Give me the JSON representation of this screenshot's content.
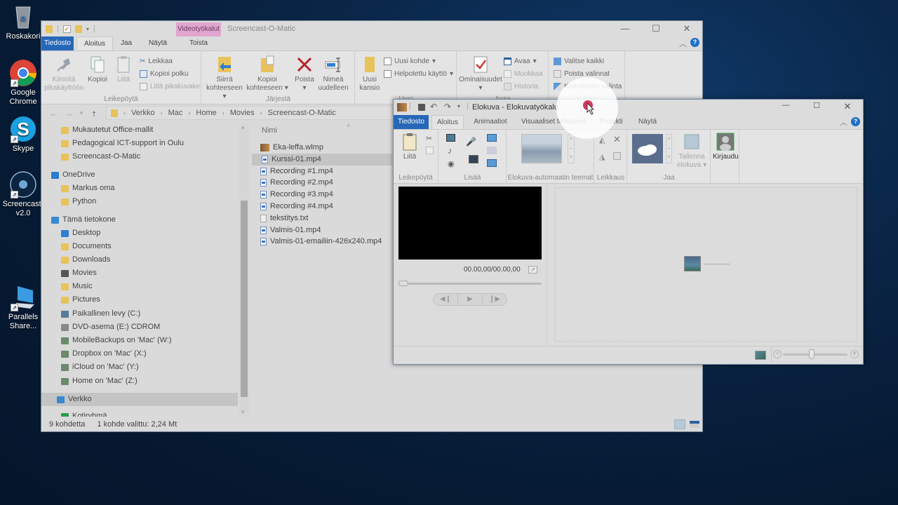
{
  "desktop": {
    "icons": [
      {
        "label": "Roskakori",
        "icon": "recycle-bin-icon"
      },
      {
        "label": "Google Chrome",
        "icon": "chrome-icon"
      },
      {
        "label": "Skype",
        "icon": "skype-icon"
      },
      {
        "label": "Screencast-v2.0",
        "icon": "screencast-icon"
      },
      {
        "label": "Parallels Share...",
        "icon": "parallels-share-icon"
      }
    ]
  },
  "explorer": {
    "title": "Screencast-O-Matic",
    "context_tab": "Videotyökalut",
    "tabs": [
      "Tiedosto",
      "Aloitus",
      "Jaa",
      "Näytä",
      "Toista"
    ],
    "ribbon": {
      "leikepoyta": {
        "label": "Leikepöytä",
        "pin": "Kiinnitä pikakäyttöön",
        "copy": "Kopioi",
        "paste": "Liitä",
        "cut": "Leikkaa",
        "copy_path": "Kopioi polku",
        "paste_shortcut": "Liitä pikakuvake"
      },
      "jarjesta": {
        "label": "Järjestä",
        "move_to": "Siirrä kohteeseen",
        "copy_to": "Kopioi kohteeseen",
        "delete": "Poista",
        "rename": "Nimeä uudelleen"
      },
      "uusi": {
        "label": "Uusi",
        "new_folder": "Uusi kansio",
        "new_item": "Uusi kohde",
        "easy_access": "Helpotettu käyttö"
      },
      "avaa": {
        "label": "Avaa",
        "properties": "Ominaisuudet",
        "open": "Avaa",
        "edit": "Muokkaa",
        "history": "Historia"
      },
      "valitse": {
        "label": "Valitse",
        "select_all": "Valitse kaikki",
        "select_none": "Poista valinnat",
        "invert": "Käänteinen valinta"
      }
    },
    "breadcrumb": [
      "Verkko",
      "Mac",
      "Home",
      "Movies",
      "Screencast-O-Matic"
    ],
    "nav": [
      {
        "label": "Mukautetut Office-mallit",
        "icon": "folder-icon"
      },
      {
        "label": "Pedagogical ICT-support in Oulu",
        "icon": "folder-icon"
      },
      {
        "label": "Screencast-O-Matic",
        "icon": "folder-icon"
      },
      {
        "label": "OneDrive",
        "icon": "onedrive-icon"
      },
      {
        "label": "Markus oma",
        "icon": "folder-synced-icon"
      },
      {
        "label": "Python",
        "icon": "folder-synced-icon"
      },
      {
        "label": "Tämä tietokone",
        "icon": "computer-icon"
      },
      {
        "label": "Desktop",
        "icon": "desktop-folder-icon"
      },
      {
        "label": "Documents",
        "icon": "documents-folder-icon"
      },
      {
        "label": "Downloads",
        "icon": "downloads-folder-icon"
      },
      {
        "label": "Movies",
        "icon": "movies-folder-icon"
      },
      {
        "label": "Music",
        "icon": "music-folder-icon"
      },
      {
        "label": "Pictures",
        "icon": "pictures-folder-icon"
      },
      {
        "label": "Paikallinen levy (C:)",
        "icon": "local-disk-icon"
      },
      {
        "label": "DVD-asema (E:) CDROM",
        "icon": "dvd-drive-icon"
      },
      {
        "label": "MobileBackups on 'Mac' (W:)",
        "icon": "network-drive-icon"
      },
      {
        "label": "Dropbox on 'Mac' (X:)",
        "icon": "network-drive-icon"
      },
      {
        "label": "iCloud on 'Mac' (Y:)",
        "icon": "network-drive-icon"
      },
      {
        "label": "Home on 'Mac' (Z:)",
        "icon": "network-drive-icon"
      },
      {
        "label": "Verkko",
        "icon": "network-icon"
      },
      {
        "label": "Kotiryhmä",
        "icon": "homegroup-icon"
      }
    ],
    "column_header": "Nimi",
    "files": [
      {
        "name": "Eka-leffa.wlmp",
        "type": "project"
      },
      {
        "name": "Kurssi-01.mp4",
        "type": "video",
        "selected": true
      },
      {
        "name": "Recording #1.mp4",
        "type": "video"
      },
      {
        "name": "Recording #2.mp4",
        "type": "video"
      },
      {
        "name": "Recording #3.mp4",
        "type": "video"
      },
      {
        "name": "Recording #4.mp4",
        "type": "video"
      },
      {
        "name": "tekstitys.txt",
        "type": "text"
      },
      {
        "name": "Valmis-01.mp4",
        "type": "video"
      },
      {
        "name": "Valmis-01-emailiin-426x240.mp4",
        "type": "video"
      }
    ],
    "status": {
      "count": "9 kohdetta",
      "selection": "1 kohde valittu: 2,24 Mt"
    }
  },
  "moviemaker": {
    "title": "Elokuva - Elokuvatyökalu",
    "tabs": [
      "Tiedosto",
      "Aloitus",
      "Animaatiot",
      "Visuaaliset tehosteet",
      "Projekti",
      "Näytä"
    ],
    "groups": {
      "clipboard": "Leikepöytä",
      "paste": "Liitä",
      "add": "Lisää",
      "themes": "Elokuva-automaatin teemat",
      "editing": "Leikkaus",
      "share": "Jaa",
      "save_movie": "Tallenna elokuva",
      "sign_in": "Kirjaudu"
    },
    "time": "00.00,00/00.00,00",
    "zoom_level": 0.45
  },
  "colors": {
    "accent": "#2767b8",
    "context_tab": "#e1a6cf",
    "cursor": "#d33a5c"
  }
}
